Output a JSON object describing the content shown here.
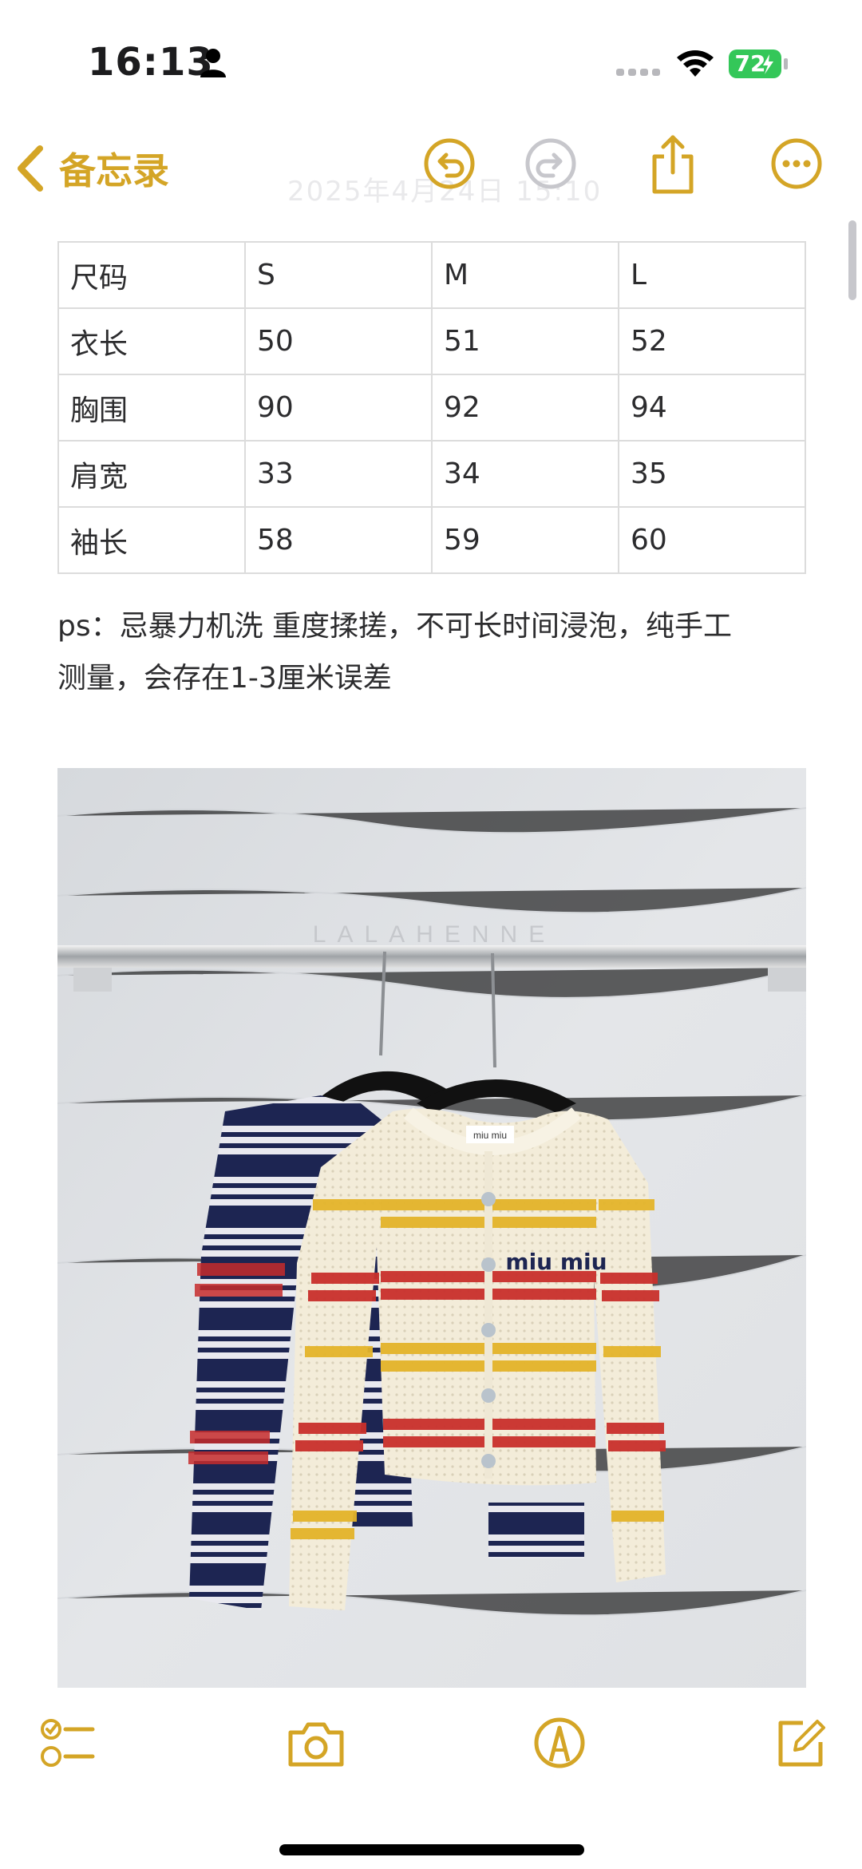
{
  "status_bar": {
    "time": "16:13",
    "battery": "72"
  },
  "nav": {
    "back_label": "备忘录",
    "ghost_text": "2025年4月24日 15:10"
  },
  "size_table": {
    "rows": [
      [
        "尺码",
        "S",
        "M",
        "L"
      ],
      [
        "衣长",
        "50",
        "51",
        "52"
      ],
      [
        "胸围",
        "90",
        "92",
        "94"
      ],
      [
        "肩宽",
        "33",
        "34",
        "35"
      ],
      [
        "袖长",
        "58",
        "59",
        "60"
      ]
    ]
  },
  "note": {
    "line1": "ps：忌暴力机洗 重度揉搓，不可长时间浸泡，纯手工",
    "line2": "测量，会存在1-3厘米误差"
  },
  "photo": {
    "watermark": "LALAHENNE",
    "label_text": "miu miu",
    "chest_logo": "miu miu"
  },
  "colors": {
    "accent": "#d4a526",
    "battery_green": "#34c759"
  },
  "icons": {
    "back": "chevron-left-icon",
    "undo": "undo-icon",
    "redo": "redo-icon",
    "share": "share-icon",
    "more": "more-icon",
    "checklist": "checklist-icon",
    "camera": "camera-icon",
    "markup": "markup-pen-icon",
    "compose": "compose-icon"
  }
}
